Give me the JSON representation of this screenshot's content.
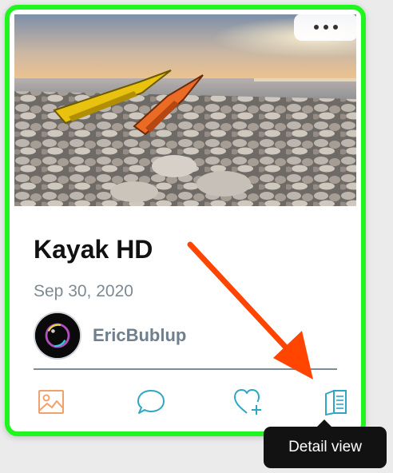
{
  "post": {
    "title": "Kayak HD",
    "date": "Sep 30, 2020",
    "author": "EricBublup"
  },
  "actions": [
    {
      "name": "image-icon",
      "color": "#f2a16b"
    },
    {
      "name": "comment-icon",
      "color": "#2fa6c4"
    },
    {
      "name": "heart-plus-icon",
      "color": "#2fa6c4"
    },
    {
      "name": "book-icon",
      "color": "#2fa6c4"
    }
  ],
  "tooltip": {
    "text": "Detail view"
  },
  "colors": {
    "card_border": "#1ef61e",
    "annotation_arrow": "#ff4500",
    "date_text": "#7d8a93",
    "author_text": "#6e7f8d"
  }
}
